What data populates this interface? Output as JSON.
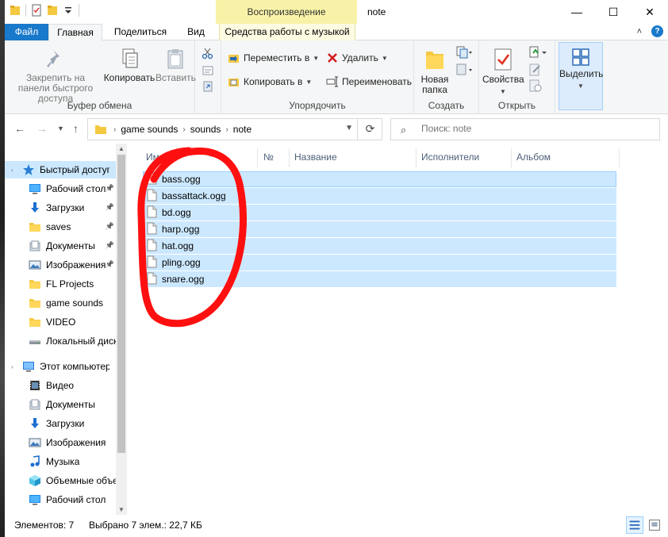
{
  "window": {
    "title": "note",
    "context_tab_group": "Воспроизведение",
    "controls": {
      "minimize": "—",
      "maximize": "☐",
      "close": "✕"
    }
  },
  "tabs": {
    "file": "Файл",
    "home": "Главная",
    "share": "Поделиться",
    "view": "Вид",
    "music_tools": "Средства работы с музыкой",
    "collapse": "˄",
    "help": "?"
  },
  "ribbon": {
    "clipboard": {
      "label": "Буфер обмена",
      "pin_quick_access": "Закрепить на панели быстрого доступа",
      "copy": "Копировать",
      "paste": "Вставить"
    },
    "organize": {
      "label": "Упорядочить",
      "move_to": "Переместить в",
      "copy_to": "Копировать в",
      "delete": "Удалить",
      "rename": "Переименовать"
    },
    "new": {
      "label": "Создать",
      "new_folder": "Новая папка"
    },
    "open": {
      "label": "Открыть",
      "properties": "Свойства"
    },
    "select": {
      "label": "Выделить"
    }
  },
  "address": {
    "crumbs": [
      "game sounds",
      "sounds",
      "note"
    ],
    "search_placeholder": "Поиск: note"
  },
  "nav": {
    "quick_access": "Быстрый доступ",
    "quick_items": [
      {
        "label": "Рабочий стол",
        "icon": "desktop-icon"
      },
      {
        "label": "Загрузки",
        "icon": "download-icon"
      },
      {
        "label": "saves",
        "icon": "folder-icon"
      },
      {
        "label": "Документы",
        "icon": "documents-icon"
      },
      {
        "label": "Изображения",
        "icon": "pictures-icon"
      },
      {
        "label": "FL Projects",
        "icon": "folder-icon"
      },
      {
        "label": "game sounds",
        "icon": "folder-icon"
      },
      {
        "label": "VIDEO",
        "icon": "folder-icon"
      },
      {
        "label": "Локальный диск",
        "icon": "drive-icon"
      }
    ],
    "this_pc": "Этот компьютер",
    "pc_items": [
      {
        "label": "Видео",
        "icon": "video-icon"
      },
      {
        "label": "Документы",
        "icon": "documents-icon"
      },
      {
        "label": "Загрузки",
        "icon": "download-icon"
      },
      {
        "label": "Изображения",
        "icon": "pictures-icon"
      },
      {
        "label": "Музыка",
        "icon": "music-icon"
      },
      {
        "label": "Объемные объекты",
        "icon": "3d-objects-icon"
      },
      {
        "label": "Рабочий стол",
        "icon": "desktop-icon"
      }
    ]
  },
  "columns": {
    "name_partial": "Им",
    "number": "№",
    "title": "Название",
    "artists": "Исполнители",
    "album": "Альбом"
  },
  "files": [
    "bass.ogg",
    "bassattack.ogg",
    "bd.ogg",
    "harp.ogg",
    "hat.ogg",
    "pling.ogg",
    "snare.ogg"
  ],
  "status": {
    "count": "Элементов: 7",
    "selected": "Выбрано 7 элем.: 22,7 КБ"
  },
  "colors": {
    "accent": "#1979ca",
    "selection": "#cce8ff",
    "annotation": "#ff0000",
    "context_tab": "#f8f2a8"
  }
}
